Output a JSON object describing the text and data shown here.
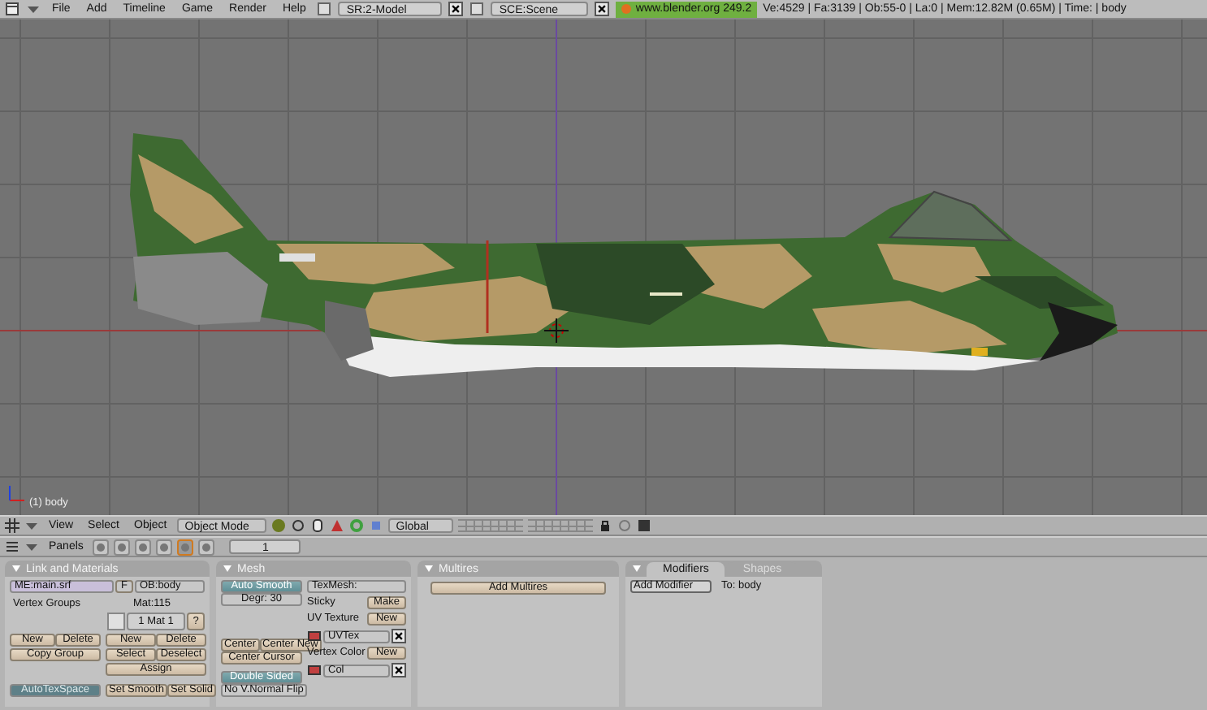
{
  "top_bar": {
    "menus": [
      "File",
      "Add",
      "Timeline",
      "Game",
      "Render",
      "Help"
    ],
    "screen": "SR:2-Model",
    "scene": "SCE:Scene",
    "version_label": "www.blender.org 249.2",
    "stats": "Ve:4529 | Fa:3139 | Ob:55-0 | La:0 | Mem:12.82M (0.65M) | Time: | body"
  },
  "viewport": {
    "object_label": "(1) body"
  },
  "view_header": {
    "menus": [
      "View",
      "Select",
      "Object"
    ],
    "mode": "Object Mode",
    "orientation": "Global"
  },
  "buttons_header": {
    "label": "Panels",
    "context_tabs": [
      {
        "selected": false
      },
      {
        "selected": false
      },
      {
        "selected": false
      },
      {
        "selected": false
      },
      {
        "selected": true
      },
      {
        "selected": false
      }
    ],
    "frame": "1"
  },
  "link_and_materials": {
    "title": "Link and Materials",
    "mesh": "ME:main.srf",
    "fake_user": "F",
    "object": "OB:body",
    "vertex_groups": "Vertex Groups",
    "material_count": "Mat:115",
    "material": "1 Mat 1",
    "help": "?",
    "group_buttons": [
      "New",
      "Delete"
    ],
    "copy_group": "Copy Group",
    "material_buttons": [
      "New",
      "Delete",
      "Select",
      "Deselect"
    ],
    "assign": "Assign",
    "auto_tex_space": {
      "label": "AutoTexSpace",
      "on": true
    },
    "smooth_buttons": [
      "Set Smooth",
      "Set Solid"
    ]
  },
  "mesh_panel": {
    "title": "Mesh",
    "auto_smooth": {
      "label": "Auto Smooth",
      "on": true
    },
    "degree": "Degr: 30",
    "tex_mesh": "TexMesh:",
    "sticky": {
      "label": "Sticky",
      "button": "Make"
    },
    "uv_texture": {
      "label": "UV Texture",
      "button": "New",
      "layer": "UVTex"
    },
    "vertex_color": {
      "label": "Vertex Color",
      "button": "New",
      "layer": "Col"
    },
    "center_buttons": [
      "Center",
      "Center New"
    ],
    "center_cursor": "Center Cursor",
    "double_sided": {
      "label": "Double Sided",
      "on": true
    },
    "normal_flip": {
      "label": "No V.Normal Flip",
      "on": false
    }
  },
  "multires_panel": {
    "title": "Multires",
    "button": "Add Multires"
  },
  "modifiers_panel": {
    "tabs": [
      {
        "label": "Modifiers",
        "selected": true
      },
      {
        "label": "Shapes",
        "selected": false
      }
    ],
    "button": "Add Modifier",
    "target": "To: body"
  }
}
